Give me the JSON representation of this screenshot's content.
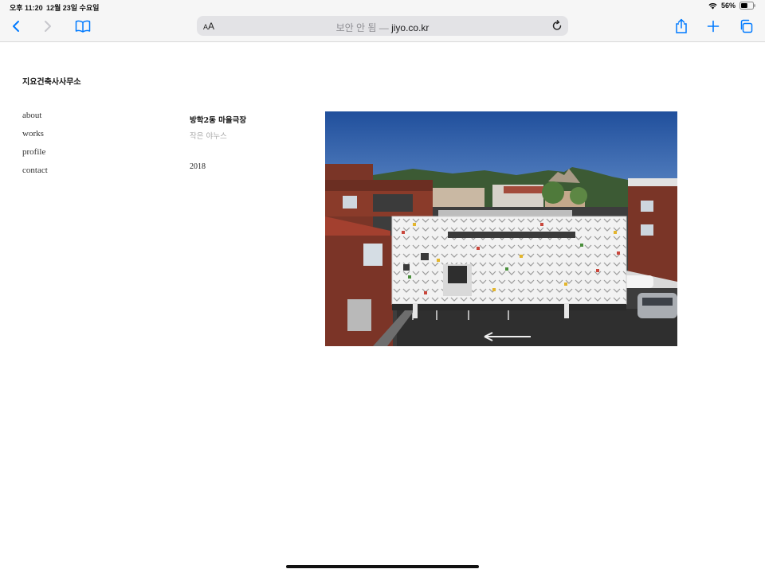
{
  "status_bar": {
    "time": "오후 11:20",
    "date": "12월 23일 수요일",
    "battery": "56%",
    "battery_level": 0.56
  },
  "browser": {
    "aa_label": "AA",
    "address_prefix": "보안 안 됨 — ",
    "address_domain": "jiyo.co.kr",
    "icons": [
      "back-icon",
      "forward-icon",
      "bookmarks-icon",
      "share-icon",
      "plus-icon",
      "tabs-icon",
      "reload-icon"
    ]
  },
  "site": {
    "title": "지요건축사사무소",
    "nav": [
      "about",
      "works",
      "profile",
      "contact"
    ]
  },
  "project": {
    "title": "방학2동 마을극장",
    "subtitle": "작은 야누스",
    "year": "2018"
  },
  "colors": {
    "accent": "#007aff",
    "sky": "#2f5ea8",
    "brick": "#8a3b2a",
    "facade": "#f1f1f1"
  }
}
